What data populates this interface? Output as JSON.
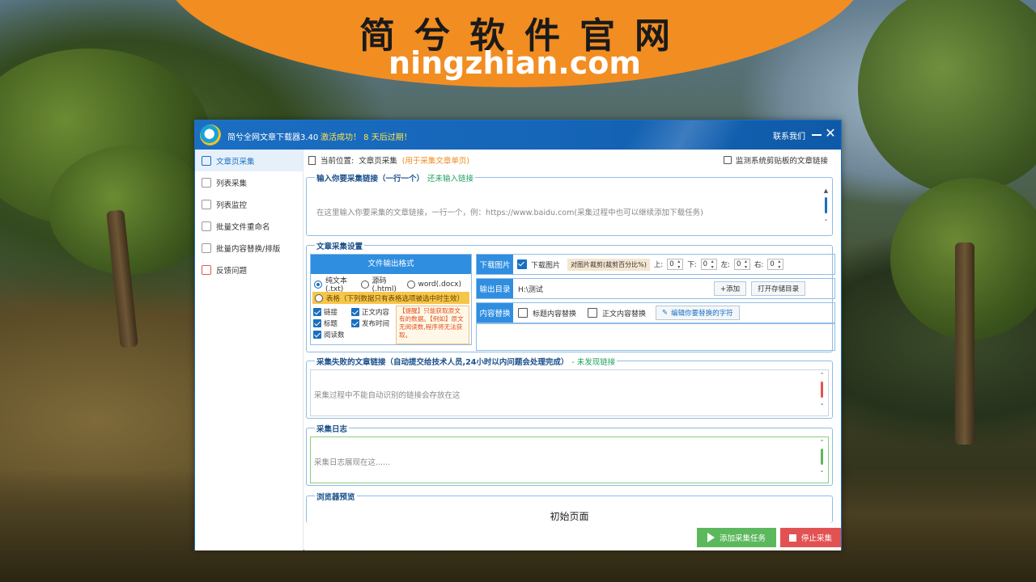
{
  "banner": {
    "title": "简兮软件官网",
    "url": "ningzhian.com"
  },
  "window": {
    "title": "简兮全网文章下载器3.40",
    "activation": "激活成功！ 8 天后过期！",
    "contact": "联系我们",
    "close_glyph": "✕"
  },
  "sidebar": {
    "items": [
      {
        "label": "文章页采集",
        "icon": "document-icon"
      },
      {
        "label": "列表采集",
        "icon": "list-icon"
      },
      {
        "label": "列表监控",
        "icon": "monitor-icon"
      },
      {
        "label": "批量文件重命名",
        "icon": "rename-icon"
      },
      {
        "label": "批量内容替换/排版",
        "icon": "replace-icon"
      },
      {
        "label": "反馈问题",
        "icon": "feedback-icon"
      }
    ]
  },
  "breadcrumb": {
    "label": "当前位置:",
    "page": "文章页采集",
    "note": "(用于采集文章单页)"
  },
  "monitor_clipboard": "监测系统剪贴板的文章链接",
  "url_group": {
    "label": "输入你要采集链接（一行一个）",
    "status": "还未输入链接",
    "placeholder": "在这里输入你要采集的文章链接，一行一个，例：https://www.baidu.com(采集过程中也可以继续添加下载任务)"
  },
  "settings": {
    "label": "文章采集设置",
    "format_head": "文件输出格式",
    "formats": [
      "纯文本(.txt)",
      "源码(.html)",
      "word(.docx)"
    ],
    "table_option": "表格（下列数据只有表格选项被选中时生效）",
    "fields_col1": [
      "链接",
      "标题",
      "阅读数"
    ],
    "fields_col2": [
      "正文内容",
      "发布时间"
    ],
    "tip": "【提醒】只能获取原文有的数据。【例如】原文无阅读数,程序将无法获取。",
    "download_tag": "下载图片",
    "download_check": "下载图片",
    "crop_label": "对图片裁剪(裁剪百分比%)",
    "crop": [
      {
        "label": "上:",
        "value": "0"
      },
      {
        "label": "下:",
        "value": "0"
      },
      {
        "label": "左:",
        "value": "0"
      },
      {
        "label": "右:",
        "value": "0"
      }
    ],
    "output_tag": "输出目录",
    "output_value": "H:\\测试",
    "add_button": "+添加",
    "open_button": "打开存储目录",
    "replace_tag": "内容替换",
    "replace_title": "标题内容替换",
    "replace_body": "正文内容替换",
    "edit_button": "编辑你要替换的字符"
  },
  "failed_group": {
    "label": "采集失败的文章链接（自动提交给技术人员,24小时以内问题会处理完成）",
    "status": "- 未发现链接",
    "placeholder": "采集过程中不能自动识别的链接会存放在这"
  },
  "log_group": {
    "label": "采集日志",
    "placeholder": "采集日志展现在这......"
  },
  "browser_group": {
    "label": "浏览器预览",
    "page_title": "初始页面"
  },
  "buttons": {
    "start": "添加采集任务",
    "stop": "停止采集"
  },
  "colors": {
    "accent": "#1a6fc0",
    "orange": "#f28d22",
    "green": "#5cb85c",
    "red": "#e35252"
  }
}
